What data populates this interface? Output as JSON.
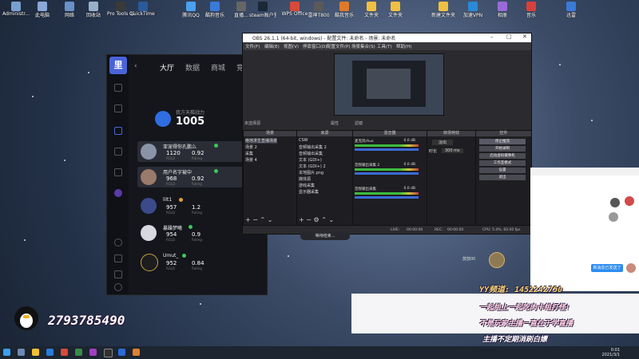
{
  "desktop": {
    "icons": [
      "Administr...",
      "此电脑",
      "网络",
      "回收站",
      "Pro Tools 12",
      "QuickTime Player",
      "腾讯QQ",
      "酷狗音乐",
      "直播...",
      "steam账户登录",
      "WPS Office",
      "雷神T800",
      "酷我音乐",
      "文件夹",
      "文件夹",
      "新建文件夹",
      "加速VPN",
      "相册",
      "音乐",
      "迅雷"
    ]
  },
  "game_client": {
    "logo_text": "里",
    "nav": [
      "大厅",
      "数据",
      "商城",
      "竞"
    ],
    "rank_title": "我方天梯战力",
    "rank_value": "1005",
    "players": [
      {
        "name": "亚宠得你孔鹏么",
        "score": "1120",
        "kda": "0.92",
        "sub1": "RGLD",
        "sub2": "Rating"
      },
      {
        "name": "用户名字被中",
        "score": "968",
        "kda": "0.92",
        "sub1": "RGLD",
        "sub2": "Rating"
      },
      {
        "name": "lilt1",
        "score": "957",
        "kda": "1.2",
        "sub1": "RGLD",
        "sub2": "Rating"
      },
      {
        "name": "暴躁梦曦",
        "score": "954",
        "kda": "0.9",
        "sub1": "RGLD",
        "sub2": "Rating"
      },
      {
        "name": "Umut_",
        "score": "952",
        "kda": "0.84",
        "sub1": "RGLD",
        "sub2": "Rating"
      }
    ]
  },
  "obs": {
    "title": "OBS 26.1.1 (64-bit, windows) - 配置文件: 未命名 - 场景: 未命名",
    "menu": [
      "文件(F)",
      "编辑(E)",
      "视图(V)",
      "停靠窗口(D)",
      "配置文件(P)",
      "场景集合(S)",
      "工具(T)",
      "帮助(H)"
    ],
    "source_caption": "未选择源",
    "preview_ctrls": [
      "属性",
      "滤镜"
    ],
    "panels": {
      "scenes": {
        "title": "场景",
        "items": [
          "绝地求生直播场景",
          "场景 2",
          "采集",
          "场景 4"
        ]
      },
      "sources": {
        "title": "来源",
        "items": [
          "CSW",
          "音频输出采集 2",
          "音频输出采集",
          "文本 (GDI+)",
          "文本 (GDI+) 2",
          "本地图片.png",
          "媒体源",
          "游戏采集",
          "显示器采集"
        ]
      },
      "mixer": {
        "title": "混音器",
        "channels": [
          {
            "name": "麦克风/Aux",
            "value": "0.0 dB"
          },
          {
            "name": "音频输出采集 2",
            "value": "0.0 dB"
          },
          {
            "name": "音频输出采集",
            "value": "0.0 dB"
          }
        ]
      },
      "transitions": {
        "title": "转场特效",
        "type": "淡出",
        "duration_label": "时长",
        "duration": "300 ms"
      },
      "controls": {
        "title": "控件",
        "buttons": [
          "停止推流",
          "开始录制",
          "启动虚拟摄像机",
          "工作室模式",
          "设置",
          "退出"
        ]
      }
    },
    "status": {
      "live_label": "LIVE:",
      "live_time": "00:00:00",
      "rec_label": "REC:",
      "rec_time": "00:00:00",
      "cpu": "CPU: 5.4%, 60.00 fps"
    }
  },
  "stream_ui": {
    "loading_text": "等待结束...",
    "dm_text": "放放00",
    "chat_reply": "新消息已发送了"
  },
  "overlay": {
    "qq_number": "2793785490",
    "yy_line": "YY频道: 1452242750",
    "line1": "一起组上一起吃肉卡组打怪!",
    "line2": "不是玩家主播一直在于学直播",
    "line3": "主播不定期消刷白嫖"
  },
  "taskbar": {
    "time": "0:01",
    "date": "2021/3/1"
  }
}
